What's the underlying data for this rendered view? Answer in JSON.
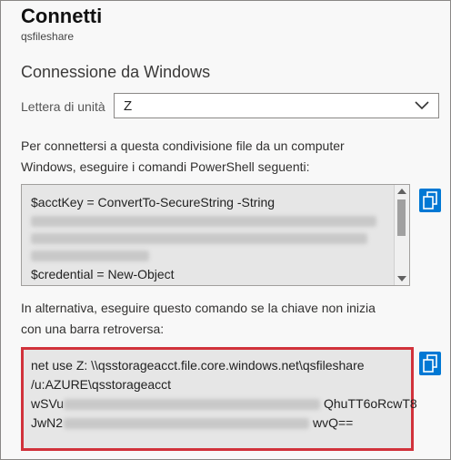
{
  "header": {
    "title": "Connetti",
    "subtitle": "qsfileshare"
  },
  "windows": {
    "heading": "Connessione da Windows",
    "drive_label": "Lettera di unità",
    "drive_value": "Z",
    "instructions_line1": "Per connettersi a questa condivisione file da un computer",
    "instructions_line2": "Windows, eseguire i comandi PowerShell seguenti:",
    "powershell": {
      "line1": "$acctKey = ConvertTo-SecureString -String",
      "line_last": "$credential = New-Object"
    },
    "alt_line1": "In alternativa, eseguire questo comando se la chiave non inizia",
    "alt_line2": "con una barra retroversa:",
    "net_use": {
      "line1": "net use Z: \\\\qsstorageacct.file.core.windows.net\\qsfileshare",
      "line2": "/u:AZURE\\qsstorageacct",
      "line3_start": "wSVu",
      "line3_end": "QhuTT6oRcwT8",
      "line4_start": "JwN2",
      "line4_end": "wvQ=="
    }
  },
  "colors": {
    "accent": "#0078d4",
    "highlight_border": "#d1323b",
    "code_background": "#e6e6e6"
  },
  "icons": {
    "copy": "copy-icon",
    "dropdown": "chevron-down-icon"
  }
}
